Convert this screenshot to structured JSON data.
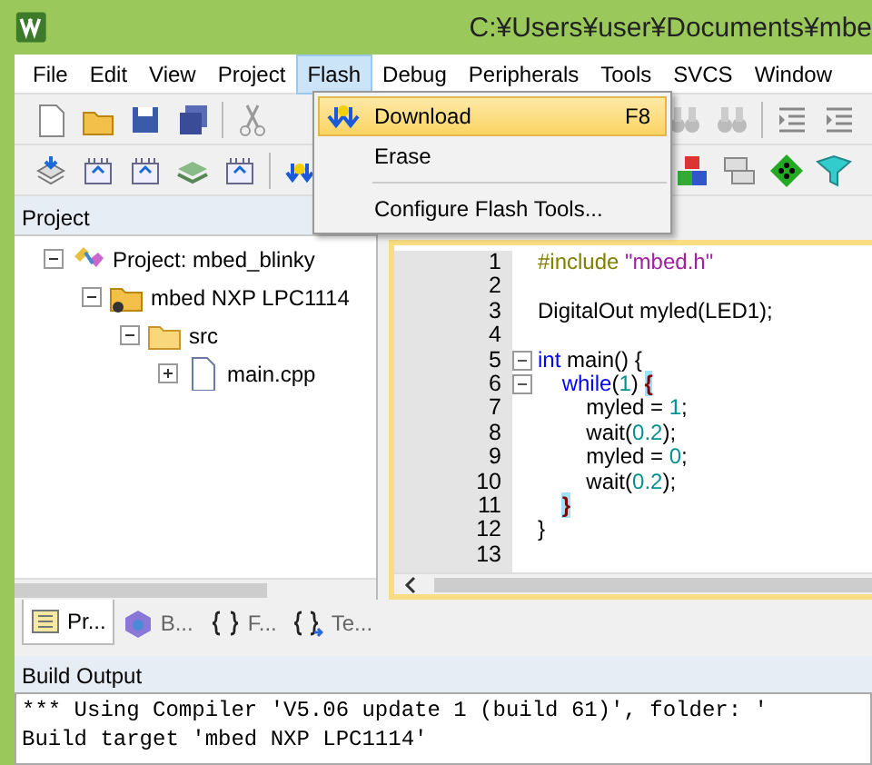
{
  "window": {
    "title": "C:¥Users¥user¥Documents¥mbe"
  },
  "menu": [
    {
      "label": "File",
      "selected": false
    },
    {
      "label": "Edit",
      "selected": false
    },
    {
      "label": "View",
      "selected": false
    },
    {
      "label": "Project",
      "selected": false
    },
    {
      "label": "Flash",
      "selected": true
    },
    {
      "label": "Debug",
      "selected": false
    },
    {
      "label": "Peripherals",
      "selected": false
    },
    {
      "label": "Tools",
      "selected": false
    },
    {
      "label": "SVCS",
      "selected": false
    },
    {
      "label": "Window",
      "selected": false
    }
  ],
  "dropdown": [
    {
      "kind": "item",
      "label": "Download",
      "shortcut": "F8",
      "selected": true,
      "icon": true
    },
    {
      "kind": "item",
      "label": "Erase",
      "selected": false,
      "icon": false
    },
    {
      "kind": "separator"
    },
    {
      "kind": "item",
      "label": "Configure Flash Tools...",
      "selected": false,
      "icon": false
    }
  ],
  "project_panel": {
    "title": "Project",
    "tree": [
      {
        "label": "Project: mbed_blinky",
        "expanded": true,
        "children": [
          {
            "label": "mbed NXP LPC1114",
            "expanded": true,
            "children": [
              {
                "label": "src",
                "expanded": true,
                "children": [
                  {
                    "label": "main.cpp",
                    "expanded": false
                  }
                ]
              }
            ]
          }
        ]
      }
    ],
    "tabs": [
      {
        "label": "Pr...",
        "selected": true
      },
      {
        "label": "B...",
        "selected": false
      },
      {
        "label": "F...",
        "selected": false
      },
      {
        "label": "Te...",
        "selected": false
      }
    ]
  },
  "editor": {
    "lines": [
      {
        "number": "1",
        "tokens": [
          {
            "kind": "directive",
            "text": "#include "
          },
          {
            "kind": "string",
            "text": "\"mbed.h\""
          }
        ]
      },
      {
        "number": "2"
      },
      {
        "number": "3",
        "tokens": [
          {
            "kind": "plain",
            "text": "DigitalOut myled(LED1);"
          }
        ]
      },
      {
        "number": "4"
      },
      {
        "number": "5",
        "fold": true,
        "tokens": [
          {
            "kind": "keyword",
            "text": "int"
          },
          {
            "kind": "plain",
            "text": " main() {"
          }
        ]
      },
      {
        "number": "6",
        "fold": true,
        "tokens": [
          {
            "kind": "keyword",
            "text": "    while"
          },
          {
            "kind": "plain",
            "text": "("
          },
          {
            "kind": "number",
            "text": "1"
          },
          {
            "kind": "plain",
            "text": ") "
          },
          {
            "kind": "brace",
            "text": "{"
          }
        ]
      },
      {
        "number": "7",
        "tokens": [
          {
            "kind": "plain",
            "text": "        myled = "
          },
          {
            "kind": "number",
            "text": "1"
          },
          {
            "kind": "plain",
            "text": ";"
          }
        ]
      },
      {
        "number": "8",
        "tokens": [
          {
            "kind": "plain",
            "text": "        wait("
          },
          {
            "kind": "number",
            "text": "0.2"
          },
          {
            "kind": "plain",
            "text": ");"
          }
        ]
      },
      {
        "number": "9",
        "tokens": [
          {
            "kind": "plain",
            "text": "        myled = "
          },
          {
            "kind": "number",
            "text": "0"
          },
          {
            "kind": "plain",
            "text": ";"
          }
        ]
      },
      {
        "number": "10",
        "tokens": [
          {
            "kind": "plain",
            "text": "        wait("
          },
          {
            "kind": "number",
            "text": "0.2"
          },
          {
            "kind": "plain",
            "text": ");"
          }
        ]
      },
      {
        "number": "11",
        "tokens": [
          {
            "kind": "brace",
            "text": "    }"
          }
        ]
      },
      {
        "number": "12",
        "tokens": [
          {
            "kind": "plain",
            "text": "}"
          }
        ]
      },
      {
        "number": "13"
      }
    ]
  },
  "build_output": {
    "title": "Build Output",
    "lines": [
      "*** Using Compiler 'V5.06 update 1 (build 61)', folder: '",
      "Build target 'mbed NXP LPC1114'"
    ]
  }
}
